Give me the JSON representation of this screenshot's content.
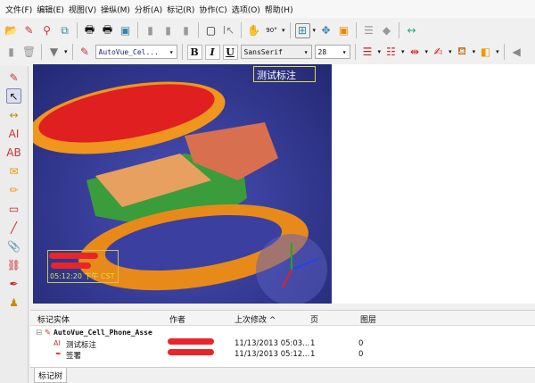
{
  "menu": [
    "文件(F)",
    "编辑(E)",
    "视图(V)",
    "操纵(M)",
    "分析(A)",
    "标记(R)",
    "协作(C)",
    "选项(O)",
    "帮助(H)"
  ],
  "toolbar": {
    "markup_file": "AutoVue_Cel...",
    "bold": "B",
    "italic": "I",
    "underline": "U",
    "font": "SansSerif",
    "size": "28",
    "rotate": "90°"
  },
  "viewport": {
    "callout": "测试标注",
    "stamp_time": "05:12:20 下午 CST"
  },
  "markup_tree": {
    "columns": [
      "标记实体",
      "作者",
      "上次修改 ^",
      "页",
      "图层"
    ],
    "root": "AutoVue_Cell_Phone_Asse",
    "rows": [
      {
        "name": "测试标注",
        "modified": "11/13/2013 05:03...",
        "page": "1",
        "layer": "0"
      },
      {
        "name": "签署",
        "modified": "11/13/2013 05:12...",
        "page": "1",
        "layer": "0"
      }
    ],
    "tab": "标记树"
  }
}
